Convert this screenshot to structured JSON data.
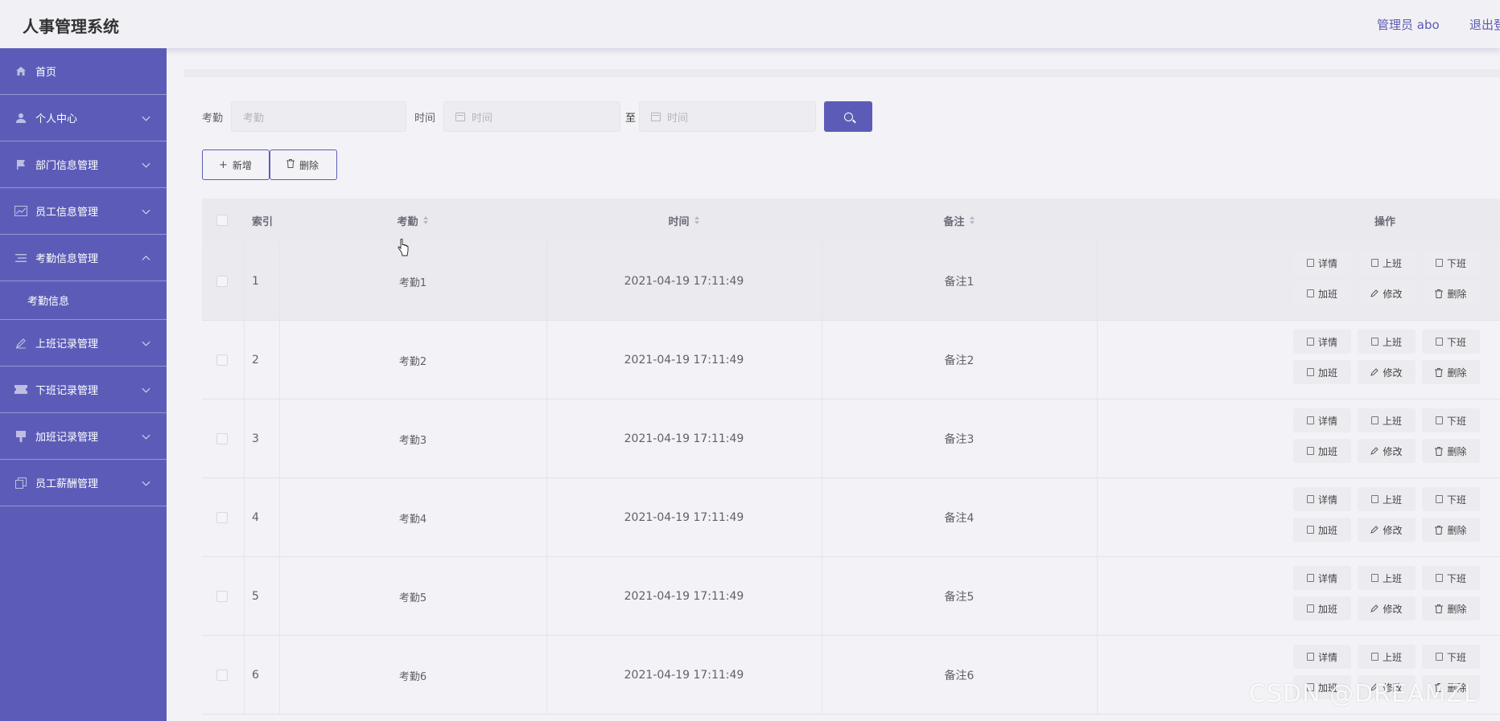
{
  "header": {
    "app_title": "人事管理系统",
    "user": "管理员 abo",
    "logout": "退出登录"
  },
  "sidebar": {
    "items": [
      {
        "label": "首页",
        "icon": "home-icon",
        "expandable": false
      },
      {
        "label": "个人中心",
        "icon": "user-icon",
        "expandable": true
      },
      {
        "label": "部门信息管理",
        "icon": "flag-icon",
        "expandable": true
      },
      {
        "label": "员工信息管理",
        "icon": "chart-icon",
        "expandable": true
      },
      {
        "label": "考勤信息管理",
        "icon": "list-icon",
        "expandable": true,
        "expanded": true,
        "children": [
          {
            "label": "考勤信息"
          }
        ]
      },
      {
        "label": "上班记录管理",
        "icon": "edit-icon",
        "expandable": true
      },
      {
        "label": "下班记录管理",
        "icon": "ticket-icon",
        "expandable": true
      },
      {
        "label": "加班记录管理",
        "icon": "stamp-icon",
        "expandable": true
      },
      {
        "label": "员工薪酬管理",
        "icon": "copy-icon",
        "expandable": true
      }
    ]
  },
  "search": {
    "kaoqin_label": "考勤",
    "kaoqin_placeholder": "考勤",
    "time_label": "时间",
    "time_start_placeholder": "时间",
    "to_label": "至",
    "time_end_placeholder": "时间"
  },
  "toolbar": {
    "add_label": "新增",
    "delete_label": "删除"
  },
  "table": {
    "columns": [
      "索引",
      "考勤",
      "时间",
      "备注",
      "操作"
    ],
    "rows": [
      {
        "index": "1",
        "kaoqin": "考勤1",
        "time": "2021-04-19 17:11:49",
        "note": "备注1"
      },
      {
        "index": "2",
        "kaoqin": "考勤2",
        "time": "2021-04-19 17:11:49",
        "note": "备注2"
      },
      {
        "index": "3",
        "kaoqin": "考勤3",
        "time": "2021-04-19 17:11:49",
        "note": "备注3"
      },
      {
        "index": "4",
        "kaoqin": "考勤4",
        "time": "2021-04-19 17:11:49",
        "note": "备注4"
      },
      {
        "index": "5",
        "kaoqin": "考勤5",
        "time": "2021-04-19 17:11:49",
        "note": "备注5"
      },
      {
        "index": "6",
        "kaoqin": "考勤6",
        "time": "2021-04-19 17:11:49",
        "note": "备注6"
      }
    ],
    "row_actions": [
      "详情",
      "上班",
      "下班",
      "加班",
      "修改",
      "删除"
    ]
  },
  "watermark": "CSDN @DREAMZL",
  "colors": {
    "primary": "#5c5cb8",
    "background": "#f3f2f6"
  }
}
